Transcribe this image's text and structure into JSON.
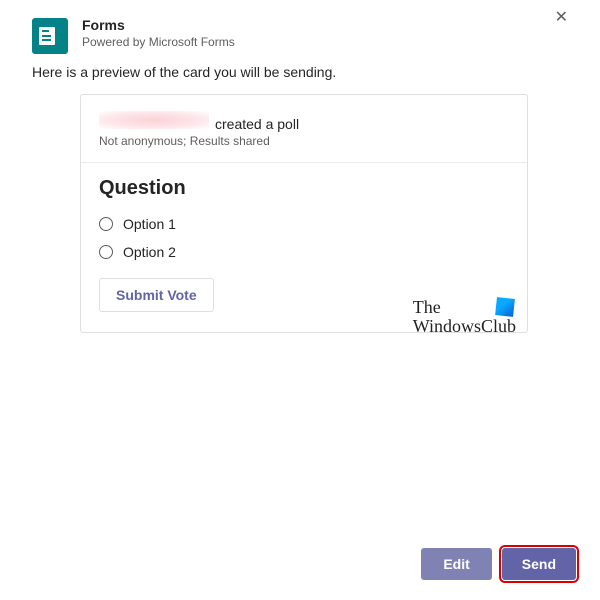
{
  "header": {
    "title": "Forms",
    "subtitle": "Powered by Microsoft Forms",
    "close_glyph": "✕"
  },
  "preview_label": "Here is a preview of the card you will be sending.",
  "card": {
    "created_suffix": "created a poll",
    "meta": "Not anonymous; Results shared",
    "question": "Question",
    "options": [
      "Option 1",
      "Option 2"
    ],
    "submit_label": "Submit Vote"
  },
  "watermark": {
    "line1": "The",
    "line2": "WindowsClub"
  },
  "footer": {
    "edit_label": "Edit",
    "send_label": "Send"
  }
}
